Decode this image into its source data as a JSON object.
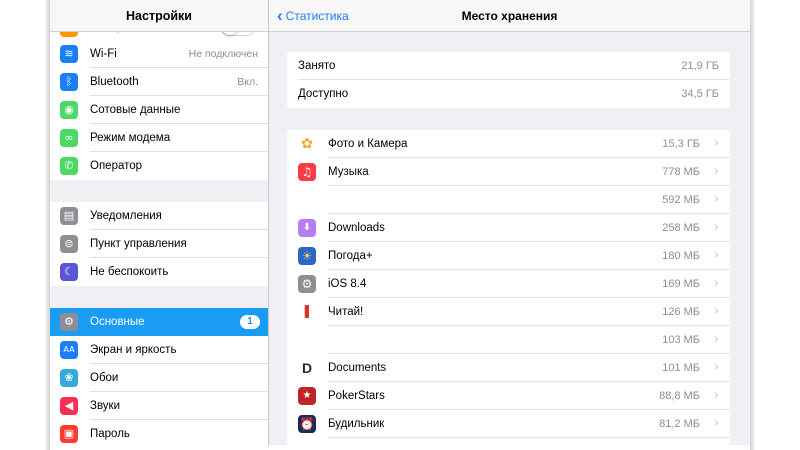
{
  "settings": {
    "title": "Настройки",
    "top_partial_label": "Авиарежим",
    "wifi": {
      "label": "Wi-Fi",
      "value": "Не подключен"
    },
    "bluetooth": {
      "label": "Bluetooth",
      "value": "Вкл."
    },
    "cellular": {
      "label": "Сотовые данные"
    },
    "hotspot": {
      "label": "Режим модема"
    },
    "carrier": {
      "label": "Оператор"
    },
    "notifications": {
      "label": "Уведомления"
    },
    "control_center": {
      "label": "Пункт управления"
    },
    "dnd": {
      "label": "Не беспокоить"
    },
    "general": {
      "label": "Основные",
      "badge": "1"
    },
    "display": {
      "label": "Экран и яркость"
    },
    "wallpaper": {
      "label": "Обои"
    },
    "sounds": {
      "label": "Звуки"
    },
    "passcode": {
      "label": "Пароль"
    }
  },
  "storage": {
    "back_label": "Статистика",
    "title": "Место хранения",
    "used": {
      "label": "Занято",
      "value": "21,9 ГБ"
    },
    "available": {
      "label": "Доступно",
      "value": "34,5 ГБ"
    },
    "apps": [
      {
        "name": "Фото и Камера",
        "size": "15,3 ГБ",
        "icon": "photos-icon",
        "color": "#ffffff"
      },
      {
        "name": "Музыка",
        "size": "778 МБ",
        "icon": "music-icon",
        "color": "#fc3c44"
      },
      {
        "name": "",
        "size": "592 МБ",
        "icon": "",
        "color": ""
      },
      {
        "name": "Downloads",
        "size": "258 МБ",
        "icon": "downloads-icon",
        "color": "#b77cf0"
      },
      {
        "name": "Погода+",
        "size": "180 МБ",
        "icon": "weather-icon",
        "color": "#2a66c9"
      },
      {
        "name": "iOS 8.4",
        "size": "169 МБ",
        "icon": "ios-settings-icon",
        "color": "#8e8e93"
      },
      {
        "name": "Читай!",
        "size": "126 МБ",
        "icon": "books-icon",
        "color": "#ffffff"
      },
      {
        "name": "",
        "size": "103 МБ",
        "icon": "",
        "color": ""
      },
      {
        "name": "Documents",
        "size": "101 МБ",
        "icon": "documents-icon",
        "color": "#ffffff"
      },
      {
        "name": "PokerStars",
        "size": "88,8 МБ",
        "icon": "pokerstars-icon",
        "color": "#c0242a"
      },
      {
        "name": "Будильник",
        "size": "81,2 МБ",
        "icon": "alarm-icon",
        "color": "#1b2a5e"
      }
    ]
  },
  "colors": {
    "accent": "#1a7ff5",
    "selection": "#1a9cf5",
    "background": "#efeff4"
  }
}
